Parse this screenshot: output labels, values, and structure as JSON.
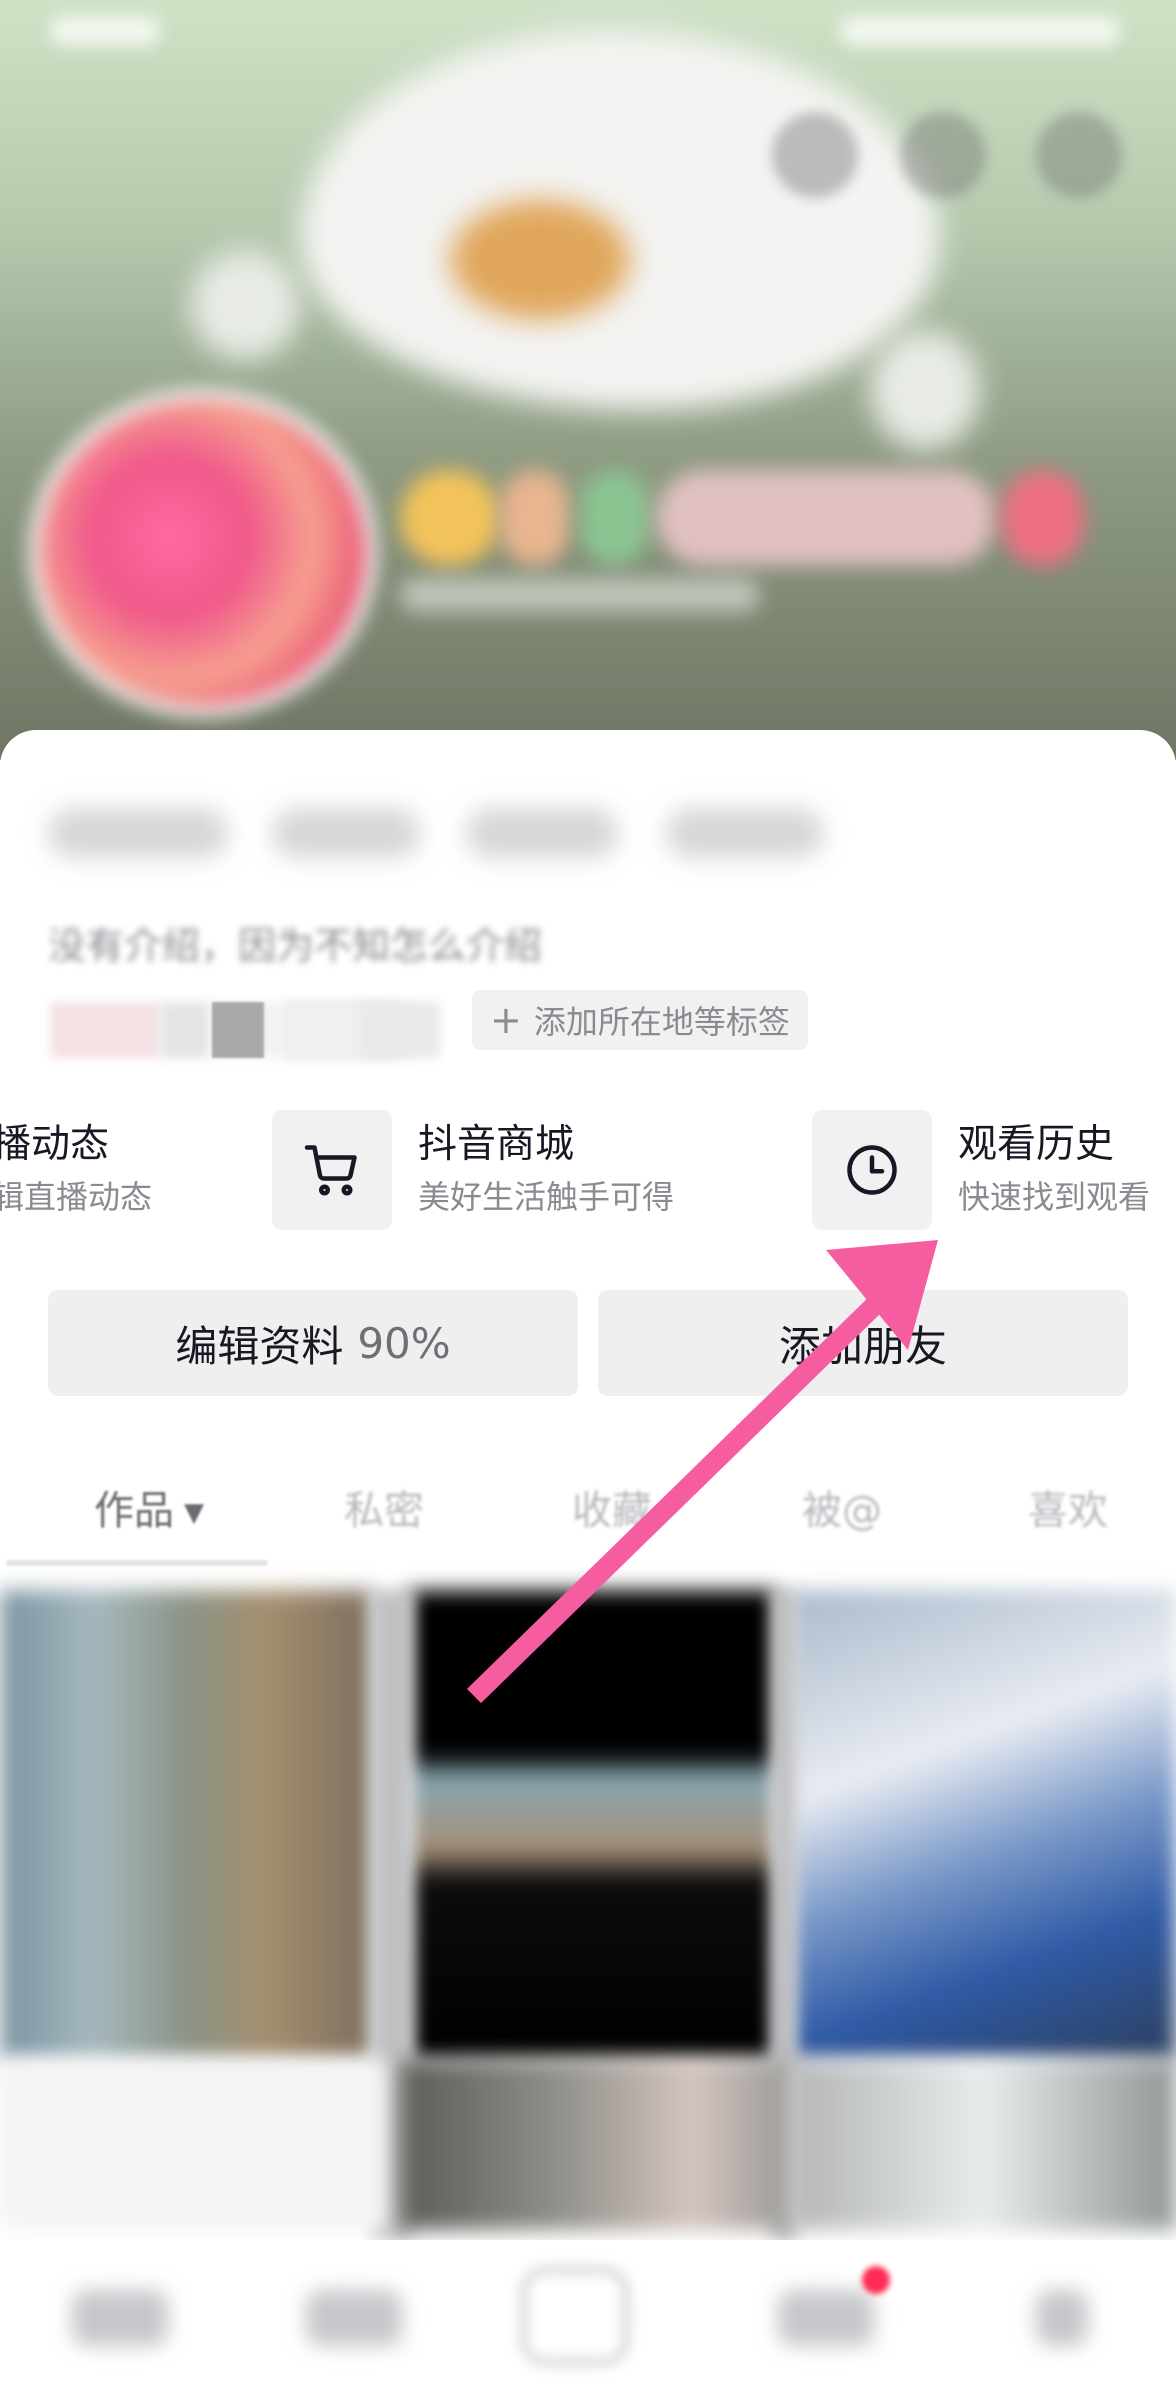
{
  "profile": {
    "bio": "没有介绍，因为不知怎么介绍",
    "add_tag_label": "添加所在地等标签"
  },
  "shortcuts": [
    {
      "title": "播动态",
      "subtitle": "辑直播动态",
      "icon": ""
    },
    {
      "title": "抖音商城",
      "subtitle": "美好生活触手可得",
      "icon": "cart-icon"
    },
    {
      "title": "观看历史",
      "subtitle": "快速找到观看",
      "icon": "clock-icon"
    }
  ],
  "actions": {
    "edit_profile": "编辑资料",
    "edit_progress": "90%",
    "add_friends": "添加朋友"
  },
  "tabs": [
    {
      "label": "作品",
      "active": true
    },
    {
      "label": "私密",
      "active": false
    },
    {
      "label": "收藏",
      "active": false
    },
    {
      "label": "被@",
      "active": false
    },
    {
      "label": "喜欢",
      "active": false
    }
  ],
  "colors": {
    "annotation_arrow": "#f55da0",
    "notification_dot": "#fe2c55"
  }
}
